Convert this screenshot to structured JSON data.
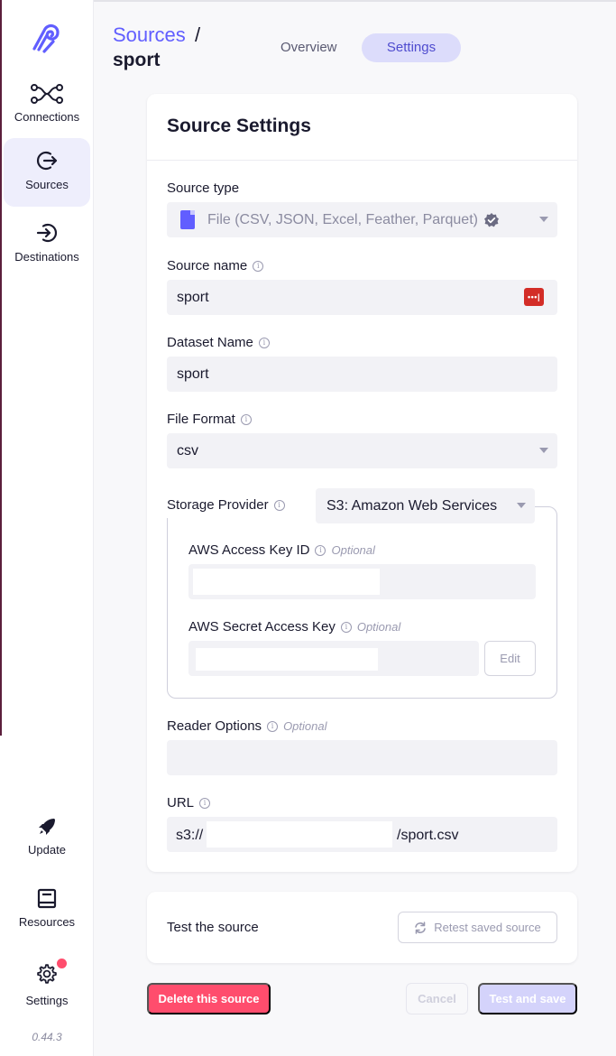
{
  "sidebar": {
    "items": [
      {
        "label": "Connections"
      },
      {
        "label": "Sources"
      },
      {
        "label": "Destinations"
      }
    ],
    "bottom_items": [
      {
        "label": "Update"
      },
      {
        "label": "Resources"
      },
      {
        "label": "Settings"
      }
    ],
    "version": "0.44.3"
  },
  "header": {
    "breadcrumb_link": "Sources",
    "breadcrumb_separator": "/",
    "breadcrumb_current": "sport",
    "tabs": [
      {
        "label": "Overview",
        "active": false
      },
      {
        "label": "Settings",
        "active": true
      }
    ]
  },
  "settings_card": {
    "title": "Source Settings",
    "source_type": {
      "label": "Source type",
      "value": "File (CSV, JSON, Excel, Feather, Parquet)"
    },
    "source_name": {
      "label": "Source name",
      "value": "sport"
    },
    "dataset_name": {
      "label": "Dataset Name",
      "value": "sport"
    },
    "file_format": {
      "label": "File Format",
      "value": "csv"
    },
    "storage_provider": {
      "label": "Storage Provider",
      "value": "S3: Amazon Web Services",
      "aws_access_key_id": {
        "label": "AWS Access Key ID",
        "optional": "Optional"
      },
      "aws_secret_access_key": {
        "label": "AWS Secret Access Key",
        "optional": "Optional",
        "edit_label": "Edit"
      }
    },
    "reader_options": {
      "label": "Reader Options",
      "optional": "Optional"
    },
    "url": {
      "label": "URL",
      "prefix": "s3://",
      "suffix": "/sport.csv"
    }
  },
  "test_card": {
    "title": "Test the source",
    "retest_label": "Retest saved source"
  },
  "actions": {
    "delete_label": "Delete this source",
    "cancel_label": "Cancel",
    "save_label": "Test and save"
  },
  "colors": {
    "accent": "#615eff",
    "danger": "#ff4d6d",
    "active_tab_bg": "#dcdcfb",
    "field_bg": "#f2f2f6"
  }
}
